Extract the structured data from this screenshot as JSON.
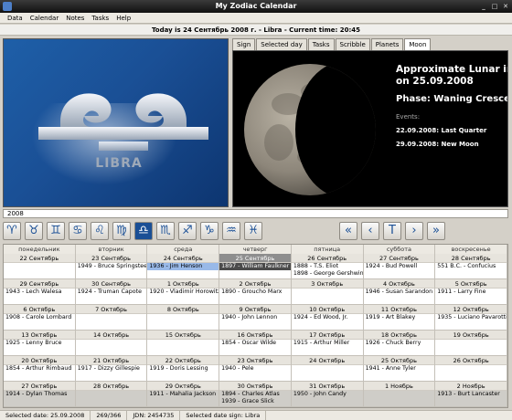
{
  "window": {
    "title": "My Zodiac Calendar"
  },
  "menu": [
    "Data",
    "Calendar",
    "Notes",
    "Tasks",
    "Help"
  ],
  "status_line": "Today is 24 Сентябрь 2008 г. - Libra - Current time: 20:45",
  "sign": {
    "name": "LIBRA",
    "symbol": "♎"
  },
  "tabs": [
    {
      "label": "Sign",
      "active": false
    },
    {
      "label": "Selected day",
      "active": false
    },
    {
      "label": "Tasks",
      "active": false
    },
    {
      "label": "Scribble",
      "active": false
    },
    {
      "label": "Planets",
      "active": false
    },
    {
      "label": "Moon",
      "active": true
    }
  ],
  "moon": {
    "title": "Approximate Lunar image on 25.09.2008",
    "phase": "Phase: Waning Crescent",
    "events_header": "Events:",
    "events": [
      "22.09.2008: Last Quarter",
      "29.09.2008: New Moon"
    ]
  },
  "year": "2008",
  "zodiac_buttons": [
    {
      "name": "aries",
      "glyph": "♈",
      "active": false
    },
    {
      "name": "taurus",
      "glyph": "♉",
      "active": false
    },
    {
      "name": "gemini",
      "glyph": "♊",
      "active": false
    },
    {
      "name": "cancer",
      "glyph": "♋",
      "active": false
    },
    {
      "name": "leo",
      "glyph": "♌",
      "active": false
    },
    {
      "name": "virgo",
      "glyph": "♍",
      "active": false
    },
    {
      "name": "libra",
      "glyph": "♎",
      "active": true
    },
    {
      "name": "scorpio",
      "glyph": "♏",
      "active": false
    },
    {
      "name": "sagittarius",
      "glyph": "♐",
      "active": false
    },
    {
      "name": "capricorn",
      "glyph": "♑",
      "active": false
    },
    {
      "name": "aquarius",
      "glyph": "♒",
      "active": false
    },
    {
      "name": "pisces",
      "glyph": "♓",
      "active": false
    }
  ],
  "nav_buttons": [
    {
      "name": "first",
      "glyph": "«"
    },
    {
      "name": "prev",
      "glyph": "‹"
    },
    {
      "name": "today",
      "glyph": "T"
    },
    {
      "name": "next",
      "glyph": "›"
    },
    {
      "name": "last",
      "glyph": "»"
    }
  ],
  "weekdays": [
    "понедельник",
    "вторник",
    "среда",
    "четверг",
    "пятница",
    "суббота",
    "воскресенье"
  ],
  "days": [
    {
      "date": "22 Сентябрь",
      "events": []
    },
    {
      "date": "23 Сентябрь",
      "events": [
        "1949 - Bruce Springsteen"
      ]
    },
    {
      "date": "24 Сентябрь",
      "events": [
        "1936 - Jim Henson"
      ],
      "selected": true
    },
    {
      "date": "25 Сентябрь",
      "events": [
        "1897 - William Faulkner"
      ],
      "today": true
    },
    {
      "date": "26 Сентябрь",
      "events": [
        "1888 - T.S. Eliot",
        "1898 - George Gershwin"
      ]
    },
    {
      "date": "27 Сентябрь",
      "events": [
        "1924 - Bud Powell"
      ]
    },
    {
      "date": "28 Сентябрь",
      "events": [
        "551 B.C. - Confucius"
      ]
    },
    {
      "date": "29 Сентябрь",
      "events": [
        "1943 - Lech Walesa"
      ]
    },
    {
      "date": "30 Сентябрь",
      "events": [
        "1924 - Truman Capote"
      ]
    },
    {
      "date": "1 Октябрь",
      "events": [
        "1920 - Vladimir Horowitz"
      ]
    },
    {
      "date": "2 Октябрь",
      "events": [
        "1890 - Groucho Marx"
      ]
    },
    {
      "date": "3 Октябрь",
      "events": []
    },
    {
      "date": "4 Октябрь",
      "events": [
        "1946 - Susan Sarandon"
      ]
    },
    {
      "date": "5 Октябрь",
      "events": [
        "1911 - Larry Fine"
      ]
    },
    {
      "date": "6 Октябрь",
      "events": [
        "1908 - Carole Lombard"
      ]
    },
    {
      "date": "7 Октябрь",
      "events": []
    },
    {
      "date": "8 Октябрь",
      "events": []
    },
    {
      "date": "9 Октябрь",
      "events": [
        "1940 - John Lennon"
      ]
    },
    {
      "date": "10 Октябрь",
      "events": [
        "1924 - Ed Wood, Jr."
      ]
    },
    {
      "date": "11 Октябрь",
      "events": [
        "1919 - Art Blakey"
      ]
    },
    {
      "date": "12 Октябрь",
      "events": [
        "1935 - Luciano Pavarotti"
      ]
    },
    {
      "date": "13 Октябрь",
      "events": [
        "1925 - Lenny Bruce"
      ]
    },
    {
      "date": "14 Октябрь",
      "events": []
    },
    {
      "date": "15 Октябрь",
      "events": []
    },
    {
      "date": "16 Октябрь",
      "events": [
        "1854 - Oscar Wilde"
      ]
    },
    {
      "date": "17 Октябрь",
      "events": [
        "1915 - Arthur Miller"
      ]
    },
    {
      "date": "18 Октябрь",
      "events": [
        "1926 - Chuck Berry"
      ]
    },
    {
      "date": "19 Октябрь",
      "events": []
    },
    {
      "date": "20 Октябрь",
      "events": [
        "1854 - Arthur Rimbaud"
      ]
    },
    {
      "date": "21 Октябрь",
      "events": [
        "1917 - Dizzy Gillespie"
      ]
    },
    {
      "date": "22 Октябрь",
      "events": [
        "1919 - Doris Lessing"
      ]
    },
    {
      "date": "23 Октябрь",
      "events": [
        "1940 - Pele"
      ]
    },
    {
      "date": "24 Октябрь",
      "events": []
    },
    {
      "date": "25 Октябрь",
      "events": [
        "1941 - Anne Tyler"
      ]
    },
    {
      "date": "26 Октябрь",
      "events": []
    },
    {
      "date": "27 Октябрь",
      "events": [
        "1914 - Dylan Thomas"
      ],
      "dim": true
    },
    {
      "date": "28 Октябрь",
      "events": [],
      "dim": true
    },
    {
      "date": "29 Октябрь",
      "events": [
        "1911 - Mahalia Jackson"
      ],
      "dim": true
    },
    {
      "date": "30 Октябрь",
      "events": [
        "1894 - Charles Atlas",
        "1939 - Grace Slick"
      ],
      "dim": true
    },
    {
      "date": "31 Октябрь",
      "events": [
        "1950 - John Candy"
      ],
      "dim": true
    },
    {
      "date": "1 Ноябрь",
      "events": [],
      "dim": true
    },
    {
      "date": "2 Ноябрь",
      "events": [
        "1913 - Burt Lancaster"
      ],
      "dim": true
    }
  ],
  "statusbar": {
    "selected_date": "Selected date: 25.09.2008",
    "day_of_year": "269/366",
    "jdn": "JDN: 2454735",
    "selected_sign": "Selected date sign: Libra"
  }
}
